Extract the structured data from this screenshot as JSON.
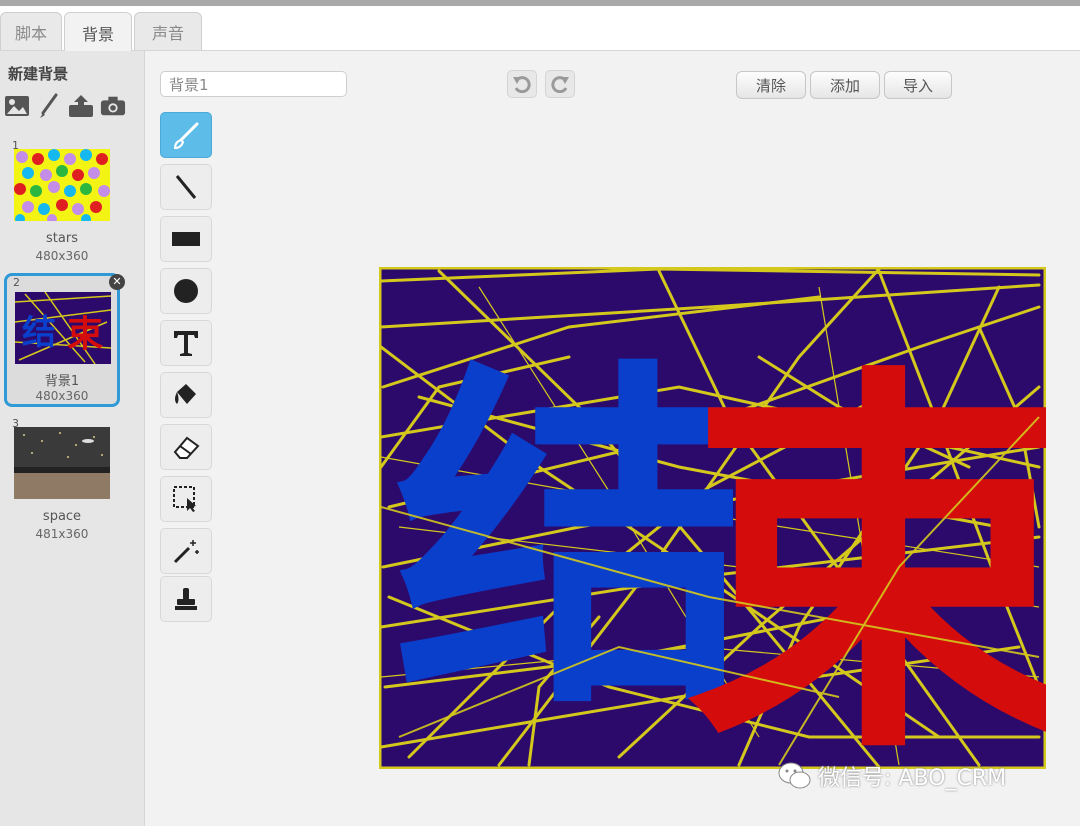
{
  "tabs": [
    {
      "label": "脚本",
      "active": false
    },
    {
      "label": "背景",
      "active": true
    },
    {
      "label": "声音",
      "active": false
    }
  ],
  "left_panel": {
    "title": "新建背景",
    "new_icons": [
      "image-icon",
      "paintbrush-icon",
      "upload-icon",
      "camera-icon"
    ],
    "backdrops": [
      {
        "num": "1",
        "name": "stars",
        "size": "480x360"
      },
      {
        "num": "2",
        "name": "背景1",
        "size": "480x360",
        "selected": true
      },
      {
        "num": "3",
        "name": "space",
        "size": "481x360"
      }
    ]
  },
  "editor": {
    "name_value": "背景1",
    "buttons": {
      "clear": "清除",
      "add": "添加",
      "import": "导入"
    },
    "tools": [
      "paintbrush-icon",
      "line-icon",
      "rectangle-icon",
      "ellipse-icon",
      "text-icon",
      "fill-icon",
      "eraser-icon",
      "select-icon",
      "magic-select-icon",
      "stamp-icon"
    ],
    "active_tool": "paintbrush-icon"
  },
  "canvas": {
    "char_left": "结",
    "char_right": "束"
  },
  "colors": {
    "accent": "#5dbde8",
    "canvas_bg": "#2c0a6b",
    "stroke_yellow": "#d4c81c",
    "char_blue": "#0a3fcc",
    "char_red": "#d40c0c"
  },
  "watermark": "微信号: ABO_CRM"
}
